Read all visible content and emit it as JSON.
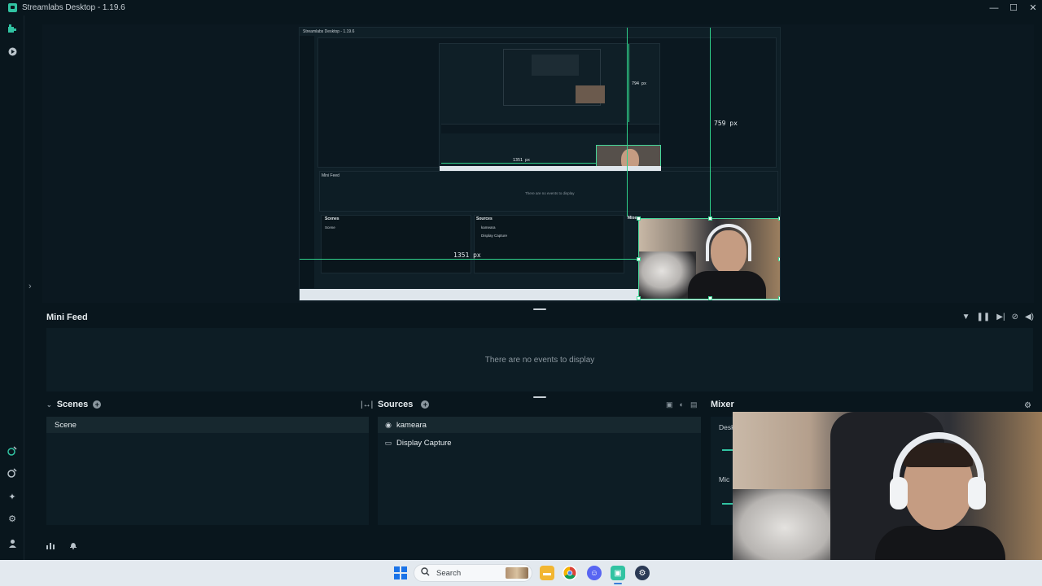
{
  "window": {
    "title": "Streamlabs Desktop - 1.19.6",
    "controls": [
      "—",
      "☐",
      "✕"
    ]
  },
  "preview": {
    "nested_title": "Streamlabs Desktop - 1.19.6",
    "measure_width": "1351  px",
    "measure_height": "759  px",
    "nested_measure_height": "794 px",
    "nested_measure_width": "1351 px",
    "nested_minifeed_title": "Mini Feed",
    "nested_minifeed_empty": "There are no events to display",
    "nested_scenes": "Scenes",
    "nested_sources": "Sources",
    "nested_mixer": "Mixer",
    "nested_scene_item": "Scene",
    "nested_source_1": "kameara",
    "nested_source_2": "Display Capture"
  },
  "minifeed": {
    "title": "Mini Feed",
    "empty_text": "There are no events to display"
  },
  "scenes": {
    "title": "Scenes",
    "items": [
      "Scene"
    ]
  },
  "sources": {
    "title": "Sources",
    "items": [
      {
        "label": "kameara",
        "icon": "webcam-icon"
      },
      {
        "label": "Display Capture",
        "icon": "monitor-icon"
      }
    ]
  },
  "mixer": {
    "title": "Mixer",
    "channels": [
      "Desk",
      "Mic"
    ]
  },
  "taskbar": {
    "search_placeholder": "Search"
  },
  "colors": {
    "accent": "#31c3a2",
    "guide": "#2fd08a",
    "background": "#09161d"
  }
}
